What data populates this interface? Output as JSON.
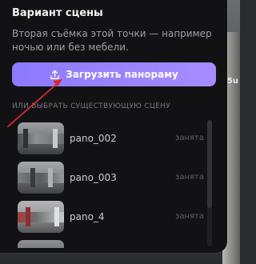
{
  "panel": {
    "title": "Вариант сцены",
    "description": "Вторая съёмка этой точки — например ночью или без мебели.",
    "upload_button_label": "Загрузить панораму",
    "existing_label": "ИЛИ ВЫБРАТЬ СУЩЕСТВУЮЩУЮ СЦЕНУ",
    "scenes": [
      {
        "name": "pano_002",
        "status": "занята",
        "icon": "panorama-thumbnail"
      },
      {
        "name": "pano_003",
        "status": "занята",
        "icon": "panorama-thumbnail"
      },
      {
        "name": "pano_4",
        "status": "занята",
        "icon": "panorama-thumbnail"
      }
    ]
  },
  "background": {
    "sign_text": "5u"
  },
  "colors": {
    "accent_start": "#8d79ff",
    "accent_end": "#a68cff",
    "panel_bg": "#121214",
    "annotation_arrow": "#d62a2a"
  }
}
